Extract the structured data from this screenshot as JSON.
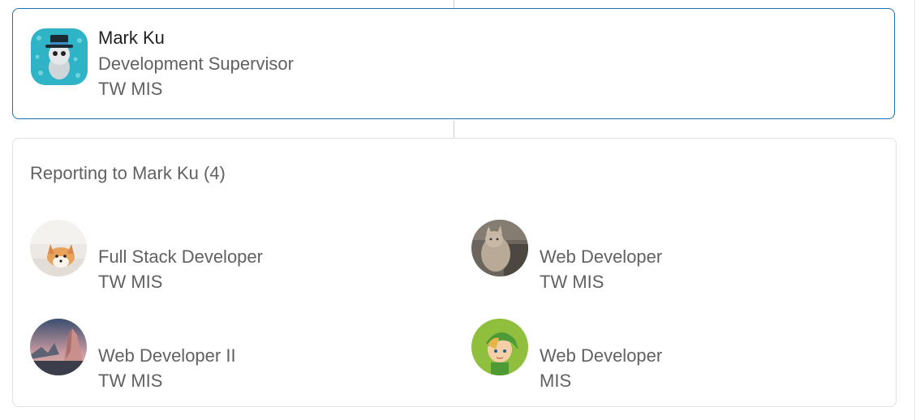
{
  "manager": {
    "name": "Mark Ku",
    "title": "Development Supervisor",
    "department": "TW MIS",
    "avatar_icon": "cartoon-character-top-hat-icon"
  },
  "reports_section": {
    "heading": "Reporting to Mark Ku (4)",
    "reports": [
      {
        "title": "Full Stack Developer",
        "department": "TW MIS",
        "avatar_icon": "corgi-photo-icon"
      },
      {
        "title": "Web Developer",
        "department": "TW MIS",
        "avatar_icon": "cat-photo-icon"
      },
      {
        "title": "Web Developer II",
        "department": "TW MIS",
        "avatar_icon": "mountain-landscape-icon"
      },
      {
        "title": "Web Developer",
        "department": "MIS",
        "avatar_icon": "cartoon-elf-icon"
      }
    ]
  },
  "colors": {
    "selected_border": "#1a73b4",
    "card_border": "#e0e0e0",
    "secondary_text": "#616161",
    "primary_text": "#1f1f1f"
  }
}
